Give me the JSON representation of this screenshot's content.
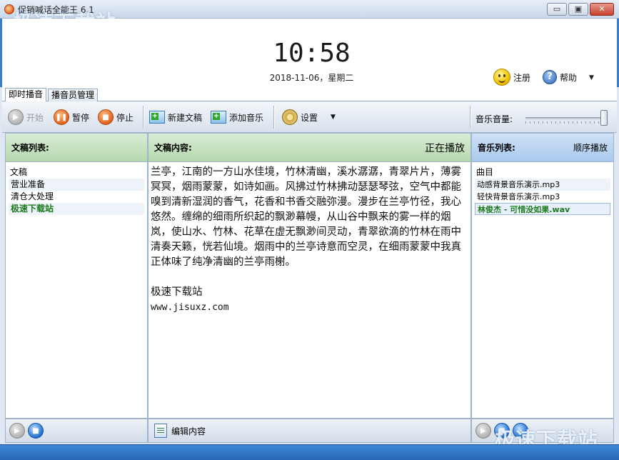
{
  "window": {
    "title": "促销喊话全能王 6.1",
    "watermark": "极速下载站",
    "controls": {
      "minimize": "▭",
      "maximize": "▣",
      "close": "✕"
    }
  },
  "header": {
    "clock": "10:58",
    "date": "2018-11-06，星期二",
    "register_label": "注册",
    "help_label": "帮助"
  },
  "tabs": [
    {
      "label": "即时播音",
      "active": true
    },
    {
      "label": "播音员管理",
      "active": false
    }
  ],
  "toolbar": {
    "start_label": "开始",
    "pause_label": "暂停",
    "stop_label": "停止",
    "new_doc_label": "新建文稿",
    "add_music_label": "添加音乐",
    "settings_label": "设置",
    "volume_label": "音乐音量:",
    "volume_level": 1.0
  },
  "doc_list": {
    "title": "文稿列表:",
    "column": "文稿",
    "items": [
      "营业准备",
      "清仓大处理",
      "极速下载站"
    ],
    "current_index": 2
  },
  "doc_content": {
    "title": "文稿内容:",
    "status": "正在播放",
    "body": "兰亭，江南的一方山水佳境，竹林清幽，溪水潺潺，青翠片片，薄雾冥冥，烟雨蒙蒙，如诗如画。风拂过竹林拂动瑟瑟琴弦，空气中都能嗅到清新湿润的香气，花香和书香交融弥漫。漫步在兰亭竹径，我心悠然。缠绵的细雨所织起的飘渺幕幔，从山谷中飘来的雾一样的烟岚，使山水、竹林、花草在虚无飘渺间灵动，青翠欲滴的竹林在雨中清奏天籁，恍若仙境。烟雨中的兰亭诗意而空灵，在细雨蒙蒙中我真正体味了纯净清幽的兰亭雨榭。",
    "signature": "极速下载站",
    "url": "www.jisuxz.com",
    "edit_label": "编辑内容"
  },
  "music_list": {
    "title": "音乐列表:",
    "mode": "顺序播放",
    "column": "曲目",
    "items": [
      "动感背景音乐演示.mp3",
      "轻快背景音乐演示.mp3",
      "林俊杰 - 可惜没如果.wav"
    ],
    "current_index": 2
  }
}
